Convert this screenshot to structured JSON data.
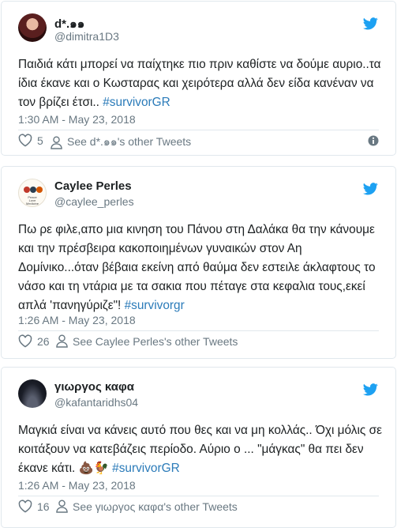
{
  "colors": {
    "hashtag": "#2b7bb9",
    "twitter_blue": "#1da1f2",
    "muted_gray": "#697882",
    "border": "#e1e8ed"
  },
  "tweets": [
    {
      "name": "d*.๑๑",
      "handle": "@dimitra1D3",
      "text": "Παιδιά κάτι μπορεί να παίχτηκε πιο πριν καθίστε να δούμε αυριο..τα ίδια έκανε και ο Κωσταρας και χειρότερα αλλά δεν είδα κανέναν να τον βρίζει έτσι..",
      "hashtag": "#survivorGR",
      "timestamp": "1:30 AM - May 23, 2018",
      "likes": "5",
      "profile_link": "See d*.๑๑'s other Tweets"
    },
    {
      "name": "Caylee Perles",
      "handle": "@caylee_perles",
      "avatar_text": [
        "Peace",
        "Love",
        "Medicine"
      ],
      "text": "Πω ρε φιλε,απο μια κινηση του Πάνου στη Δαλάκα θα την κάνουμε και την πρέσβειρα κακοποιημένων γυναικών στον Αη Δομίνικο...όταν βέβαια εκείνη από θαύμα δεν εστειλε άκλαφτους το νάσο και τη ντάρια με τα σακια που πέταγε στα κεφαλια τους,εκεί απλά 'πανηγύριζε\"!",
      "hashtag": "#survivorgr",
      "timestamp": "1:26 AM - May 23, 2018",
      "likes": "26",
      "profile_link": "See Caylee Perles's other Tweets"
    },
    {
      "name": "γιωργος καφα",
      "handle": "@kafantaridhs04",
      "text": "Μαγκιά είναι να κάνεις αυτό που θες και να μη κολλάς.. Όχι μόλις σε κοιτάξουν να κατεβάζεις περίοδο. Αύριο ο ... \"μάγκας\" θα πει δεν έκανε κάτι.",
      "emojis": "💩🐓",
      "hashtag": "#survivorGR",
      "timestamp": "1:26 AM - May 23, 2018",
      "likes": "16",
      "profile_link": "See γιωργος καφα's other Tweets"
    }
  ]
}
